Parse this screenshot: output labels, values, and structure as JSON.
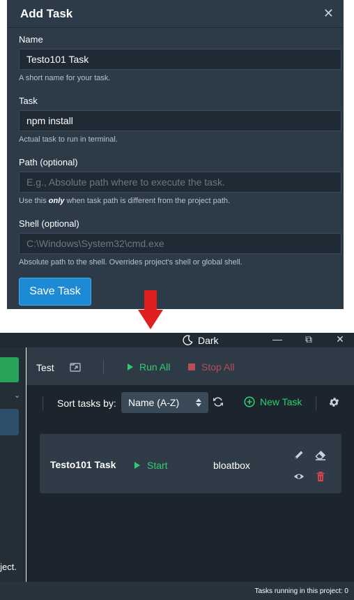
{
  "modal": {
    "title": "Add Task",
    "close_glyph": "✕",
    "fields": {
      "name": {
        "label": "Name",
        "value": "Testo101 Task",
        "help": "A short name for your task."
      },
      "task": {
        "label": "Task",
        "value": "npm install",
        "help": "Actual task to run in terminal."
      },
      "path": {
        "label": "Path (optional)",
        "placeholder": "E.g., Absolute path where to execute the task.",
        "help_before": "Use this ",
        "help_emphasis": "only",
        "help_after": " when task path is different from the project path."
      },
      "shell": {
        "label": "Shell (optional)",
        "placeholder": "C:\\Windows\\System32\\cmd.exe",
        "help": "Absolute path to the shell. Overrides project's shell or global shell."
      }
    },
    "save_label": "Save Task"
  },
  "window": {
    "theme_label": "Dark",
    "minimize_glyph": "—",
    "restore_glyph": "⧉",
    "close_glyph": "✕"
  },
  "left_panel": {
    "collapse_glyph": "⌄",
    "truncated_text": "oject."
  },
  "project": {
    "name": "Test",
    "run_all_label": "Run All",
    "stop_all_label": "Stop All"
  },
  "toolbar": {
    "sort_label": "Sort tasks by:",
    "sort_value": "Name (A-Z)",
    "new_task_label": "New Task"
  },
  "tasks": [
    {
      "name": "Testo101 Task",
      "start_label": "Start",
      "shell": "bloatbox"
    }
  ],
  "status": {
    "text": "Tasks running in this project: 0"
  },
  "colors": {
    "accent_green": "#2ecc71",
    "stop_red": "#b84d55",
    "primary_blue": "#1d8ad6",
    "delete_red": "#e0454c",
    "arrow_red": "#e02020"
  }
}
